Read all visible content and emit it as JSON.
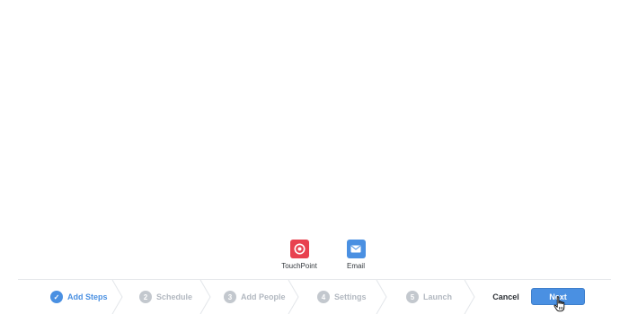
{
  "tools": [
    {
      "label": "TouchPoint",
      "icon": "touchpoint-icon",
      "color": "#e8414f"
    },
    {
      "label": "Email",
      "icon": "envelope-icon",
      "color": "#4a90e2"
    }
  ],
  "wizard": {
    "steps": [
      {
        "number": "✓",
        "label": "Add Steps",
        "state": "active"
      },
      {
        "number": "2",
        "label": "Schedule",
        "state": "inactive"
      },
      {
        "number": "3",
        "label": "Add People",
        "state": "inactive"
      },
      {
        "number": "4",
        "label": "Settings",
        "state": "inactive"
      },
      {
        "number": "5",
        "label": "Launch",
        "state": "inactive"
      }
    ]
  },
  "actions": {
    "cancel_label": "Cancel",
    "next_label": "Next"
  },
  "colors": {
    "accent": "#4a90e2",
    "touchpoint": "#e8414f",
    "inactive_step": "#b2b8c0"
  }
}
